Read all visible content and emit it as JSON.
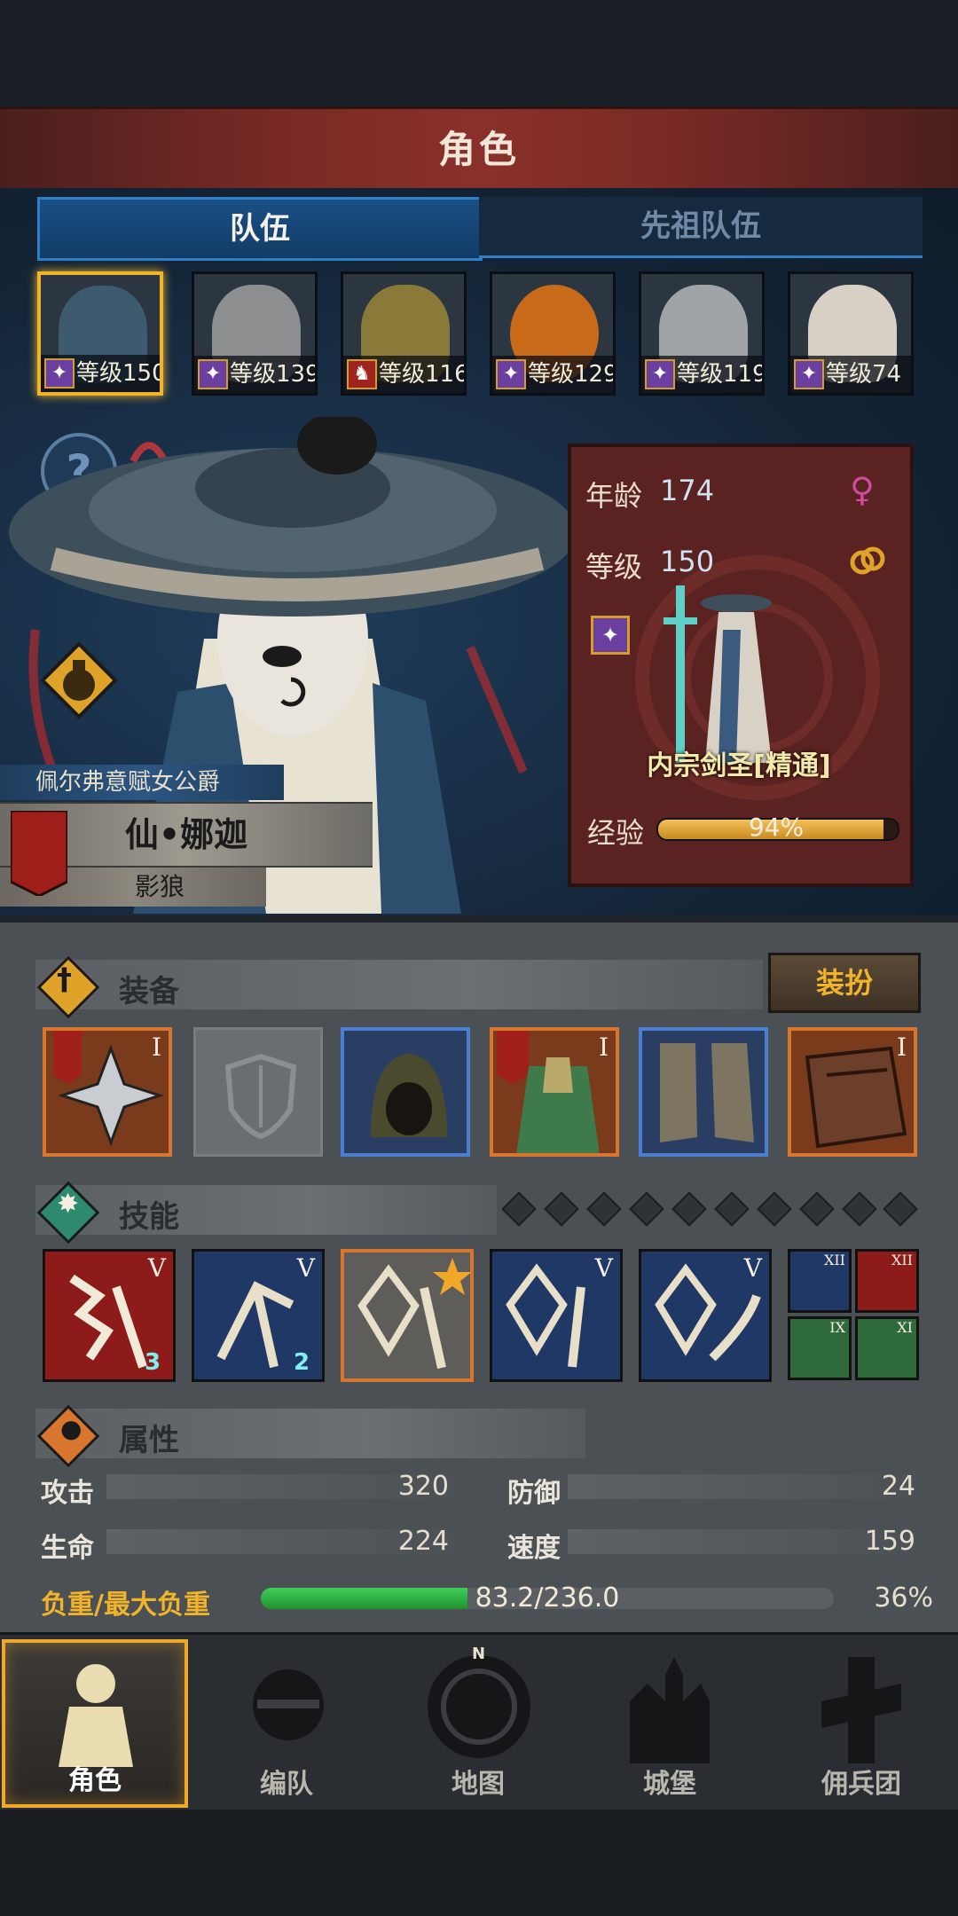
{
  "header": {
    "title": "角色"
  },
  "tabs": [
    {
      "label": "队伍",
      "active": true
    },
    {
      "label": "先祖队伍",
      "active": false
    }
  ],
  "roster": [
    {
      "level_text": "等级150",
      "selected": true,
      "face_color": "#3d5a6e"
    },
    {
      "level_text": "等级139",
      "selected": false,
      "face_color": "#8c8e90"
    },
    {
      "level_text": "等级116",
      "selected": false,
      "face_color": "#8a7a3a"
    },
    {
      "level_text": "等级129",
      "selected": false,
      "face_color": "#c86a1a"
    },
    {
      "level_text": "等级119",
      "selected": false,
      "face_color": "#a0a4a8"
    },
    {
      "level_text": "等级74",
      "selected": false,
      "face_color": "#d8d0c4"
    }
  ],
  "character": {
    "title": "佩尔弗意赋女公爵",
    "name": "仙•娜迦",
    "subtitle": "影狼",
    "age_label": "年龄",
    "age": "174",
    "level_label": "等级",
    "level": "150",
    "class_name": "内宗剑圣[精通]",
    "exp_label": "经验",
    "exp_text": "94%",
    "exp_fraction": 0.94
  },
  "equipment": {
    "title": "装备",
    "dress_button": "装扮",
    "slots": [
      {
        "type": "orange",
        "roman": "I",
        "icon": "shuriken-icon"
      },
      {
        "type": "empty",
        "roman": "",
        "icon": "shield-icon"
      },
      {
        "type": "blue",
        "roman": "",
        "icon": "hood-icon"
      },
      {
        "type": "orange",
        "roman": "I",
        "icon": "armor-icon"
      },
      {
        "type": "blue",
        "roman": "",
        "icon": "boots-icon"
      },
      {
        "type": "orange",
        "roman": "I",
        "icon": "book-icon"
      }
    ]
  },
  "skills": {
    "title": "技能",
    "big": [
      {
        "type": "red",
        "roman": "V",
        "badge": "3"
      },
      {
        "type": "blue",
        "roman": "V",
        "badge": "2"
      },
      {
        "type": "light",
        "roman": "",
        "badge": ""
      },
      {
        "type": "blue",
        "roman": "V",
        "badge": ""
      },
      {
        "type": "blue",
        "roman": "V",
        "badge": ""
      }
    ],
    "mini": [
      {
        "color": "#1f3866",
        "roman": "XII"
      },
      {
        "color": "#8c1b19",
        "roman": "XII"
      },
      {
        "color": "#2f6a3a",
        "roman": "IX"
      },
      {
        "color": "#2f6a3a",
        "roman": "XI"
      }
    ]
  },
  "attributes": {
    "title": "属性",
    "attack_label": "攻击",
    "attack": "320",
    "defense_label": "防御",
    "defense": "24",
    "hp_label": "生命",
    "hp": "224",
    "speed_label": "速度",
    "speed": "159",
    "load_label": "负重/最大负重",
    "load_text": "83.2/236.0",
    "load_percent": "36%",
    "load_fraction": 0.36
  },
  "nav": [
    {
      "label": "角色",
      "active": true
    },
    {
      "label": "编队",
      "active": false
    },
    {
      "label": "地图",
      "active": false
    },
    {
      "label": "城堡",
      "active": false
    },
    {
      "label": "佣兵团",
      "active": false
    }
  ],
  "colors": {
    "accent": "#f1b32a",
    "tab_active": "#1b4f85",
    "exp": "#e0a83a",
    "load": "#2fae4a"
  }
}
